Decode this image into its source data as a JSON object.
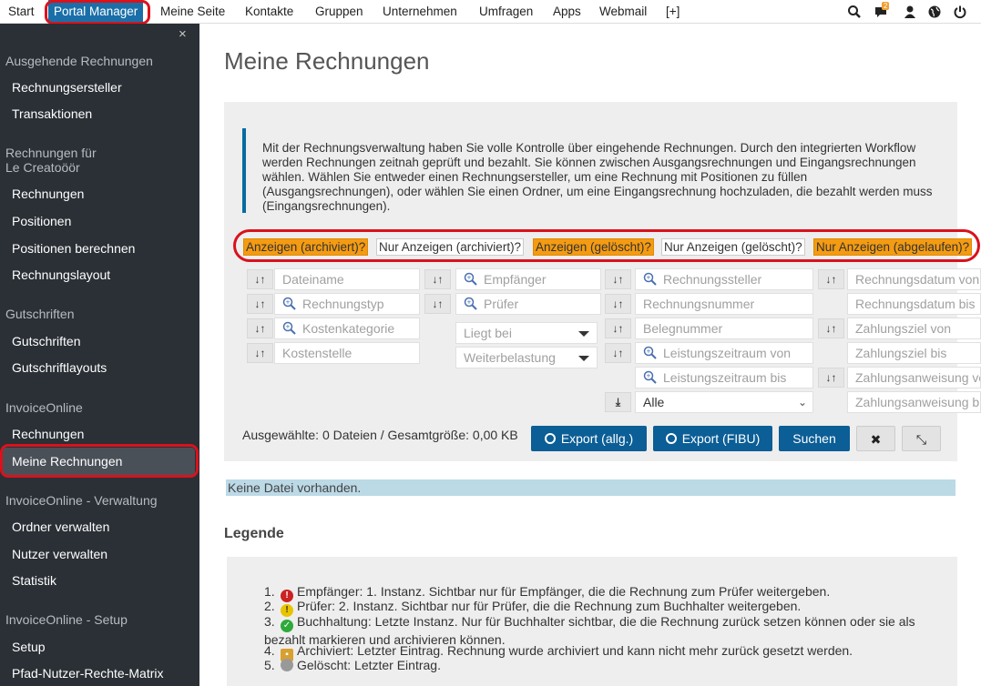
{
  "topnav": {
    "items": [
      "Start",
      "Portal Manager",
      "Meine Seite",
      "Kontakte",
      "Gruppen",
      "Unternehmen",
      "Umfragen",
      "Apps",
      "Webmail",
      "[+]"
    ],
    "badge_count": "2",
    "icons": [
      "search-icon",
      "chat-icon",
      "user-icon",
      "globe-icon",
      "power-icon"
    ]
  },
  "sidebar": {
    "close": "×",
    "sections": [
      {
        "title": "Ausgehende Rechnungen",
        "items": [
          "Rechnungsersteller",
          "Transaktionen"
        ]
      },
      {
        "title": "Rechnungen für",
        "title2": "Le Creatoöör",
        "items": [
          "Rechnungen",
          "Positionen",
          "Positionen berechnen",
          "Rechnungslayout"
        ]
      },
      {
        "title": "Gutschriften",
        "items": [
          "Gutschriften",
          "Gutschriftlayouts"
        ]
      },
      {
        "title": "InvoiceOnline",
        "items": [
          "Rechnungen",
          "Meine Rechnungen"
        ]
      },
      {
        "title": "InvoiceOnline - Verwaltung",
        "items": [
          "Ordner verwalten",
          "Nutzer verwalten",
          "Statistik"
        ]
      },
      {
        "title": "InvoiceOnline - Setup",
        "items": [
          "Setup",
          "Pfad-Nutzer-Rechte-Matrix"
        ]
      }
    ]
  },
  "main": {
    "title": "Meine Rechnungen",
    "info_text": "Mit der Rechnungsverwaltung haben Sie volle Kontrolle über eingehende Rechnungen. Durch den integrierten Workflow werden Rechnungen zeitnah geprüft und bezahlt. Sie können zwischen Ausgangsrechnungen und Eingangsrechnungen wählen. Wählen Sie entweder einen Rechnungsersteller, um eine Rechnung mit Positionen zu füllen (Ausgangsrechnungen), oder wählen Sie einen Ordner, um eine Eingangsrechnung hochzuladen, die bezahlt werden muss (Eingangsrechnungen).",
    "filters": [
      "Anzeigen (archiviert)?",
      "Nur Anzeigen (archiviert)?",
      "Anzeigen (gelöscht)?",
      "Nur Anzeigen (gelöscht)?",
      "Nur Anzeigen (abgelaufen)?"
    ],
    "filter_colors": {
      "active": "#f49b12",
      "inactive": "#ffffff"
    },
    "fields": {
      "dateiname": "Dateiname",
      "rechnungstyp": "Rechnungstyp",
      "kostenkategorie": "Kostenkategorie",
      "kostenstelle": "Kostenstelle",
      "empfaenger": "Empfänger",
      "pruefer": "Prüfer",
      "liegt_bei": "Liegt bei",
      "weiterbelastung": "Weiterbelastung",
      "rechnungssteller": "Rechnungssteller",
      "rechnungsnummer": "Rechnungsnummer",
      "belegnummer": "Belegnummer",
      "leistungszeitraum_von": "Leistungszeitraum von",
      "leistungszeitraum_bis": "Leistungszeitraum bis",
      "alle": "Alle",
      "rechnungsdatum_von": "Rechnungsdatum von",
      "rechnungsdatum_bis": "Rechnungsdatum bis",
      "zahlungsziel_von": "Zahlungsziel von",
      "zahlungsziel_bis": "Zahlungsziel bis",
      "zahlungsanweisung_von": "Zahlungsanweisung von",
      "zahlungsanweisung_bis": "Zahlungsanweisung bis"
    },
    "status": "Ausgewählte: 0 Dateien / Gesamtgröße: 0,00 KB",
    "buttons": {
      "export_allg": "Export (allg.)",
      "export_fibu": "Export (FIBU)",
      "search": "Suchen",
      "clear": "✖",
      "collapse": "⤡"
    },
    "no_file": "Keine Datei vorhanden."
  },
  "legend": {
    "title": "Legende",
    "items": [
      {
        "num": "1.",
        "text": "Empfänger: 1. Instanz. Sichtbar nur für Empfänger, die die Rechnung zum Prüfer weitergeben.",
        "icon": "exclamation-red-icon",
        "color": "#cc2222"
      },
      {
        "num": "2.",
        "text": "Prüfer: 2. Instanz. Sichtbar nur für Prüfer, die die Rechnung zum Buchhalter weitergeben.",
        "icon": "exclamation-yellow-icon",
        "color": "#e8c400"
      },
      {
        "num": "3.",
        "text": "Buchhaltung: Letzte Instanz. Nur für Buchhalter sichtbar, die die Rechnung zurück setzen können oder sie als bezahlt markieren und archivieren können.",
        "icon": "check-green-icon",
        "color": "#2eaa3a"
      },
      {
        "num": "4.",
        "text": "Archiviert: Letzter Eintrag. Rechnung wurde archiviert und kann nicht mehr zurück gesetzt werden.",
        "icon": "lock-icon",
        "color": "#d8a030"
      },
      {
        "num": "5.",
        "text": "Gelöscht: Letzter Eintrag.",
        "icon": "deleted-gray-icon",
        "color": "#999999"
      }
    ]
  }
}
